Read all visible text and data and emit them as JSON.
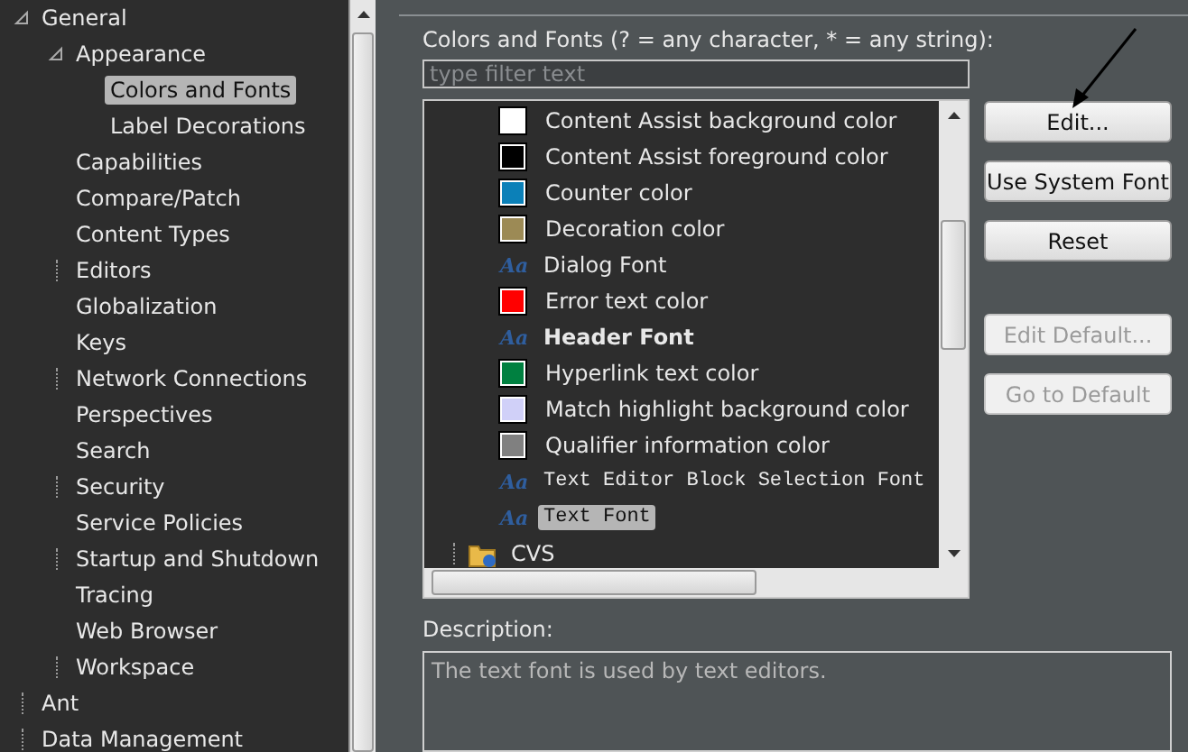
{
  "nav_tree": [
    {
      "label": "General",
      "expanded": true,
      "selected": false,
      "children": [
        {
          "label": "Appearance",
          "expanded": true,
          "selected": false,
          "children": [
            {
              "label": "Colors and Fonts",
              "selected": true
            },
            {
              "label": "Label Decorations",
              "selected": false
            }
          ]
        },
        {
          "label": "Capabilities",
          "selected": false
        },
        {
          "label": "Compare/Patch",
          "selected": false
        },
        {
          "label": "Content Types",
          "selected": false
        },
        {
          "label": "Editors",
          "expanded": false,
          "selected": false
        },
        {
          "label": "Globalization",
          "selected": false
        },
        {
          "label": "Keys",
          "selected": false
        },
        {
          "label": "Network Connections",
          "expanded": false,
          "selected": false
        },
        {
          "label": "Perspectives",
          "selected": false
        },
        {
          "label": "Search",
          "selected": false
        },
        {
          "label": "Security",
          "expanded": false,
          "selected": false
        },
        {
          "label": "Service Policies",
          "selected": false
        },
        {
          "label": "Startup and Shutdown",
          "expanded": false,
          "selected": false
        },
        {
          "label": "Tracing",
          "selected": false
        },
        {
          "label": "Web Browser",
          "selected": false
        },
        {
          "label": "Workspace",
          "expanded": false,
          "selected": false
        }
      ]
    },
    {
      "label": "Ant",
      "expanded": false,
      "selected": false
    },
    {
      "label": "Data Management",
      "expanded": false,
      "selected": false
    }
  ],
  "colors_fonts": {
    "heading": "Colors and Fonts (? = any character, * = any string):",
    "filter": {
      "placeholder": "type filter text"
    },
    "items": [
      {
        "label": "Content Assist background color",
        "kind": "color",
        "color": "#ffffff",
        "selected": false
      },
      {
        "label": "Content Assist foreground color",
        "kind": "color",
        "color": "#000000",
        "selected": false
      },
      {
        "label": "Counter color",
        "kind": "color",
        "color": "#0b80b8",
        "selected": false
      },
      {
        "label": "Decoration color",
        "kind": "color",
        "color": "#9c8a55",
        "selected": false
      },
      {
        "label": "Dialog Font",
        "kind": "font",
        "icon": "Aa",
        "selected": false
      },
      {
        "label": "Error text color",
        "kind": "color",
        "color": "#ff0000",
        "selected": false
      },
      {
        "label": "Header Font",
        "kind": "boldfont",
        "icon": "Aa",
        "selected": false
      },
      {
        "label": "Hyperlink text color",
        "kind": "color",
        "color": "#008040",
        "selected": false
      },
      {
        "label": "Match highlight background color",
        "kind": "color",
        "color": "#d0d0f8",
        "selected": false
      },
      {
        "label": "Qualifier information color",
        "kind": "color",
        "color": "#808080",
        "selected": false
      },
      {
        "label": "Text Editor Block Selection Font",
        "kind": "monofont",
        "icon": "Aa",
        "selected": false
      },
      {
        "label": "Text Font",
        "kind": "monofont",
        "icon": "Aa",
        "selected": true
      },
      {
        "label": "CVS",
        "kind": "category",
        "selected": false
      }
    ]
  },
  "buttons": [
    {
      "label": "Edit...",
      "disabled": false
    },
    {
      "label": "Use System Font",
      "disabled": false
    },
    {
      "label": "Reset",
      "disabled": false
    },
    {
      "label": "Edit Default...",
      "disabled": true
    },
    {
      "label": "Go to Default",
      "disabled": true
    }
  ],
  "description": {
    "label": "Description:",
    "text": "The text font is used by text editors."
  }
}
